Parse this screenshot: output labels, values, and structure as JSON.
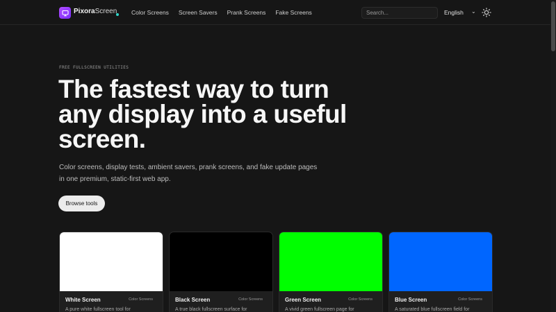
{
  "header": {
    "logo": {
      "brand": "Pixora",
      "suffix": "Screen",
      "icon": "monitor-icon"
    },
    "nav": [
      "Color Screens",
      "Screen Savers",
      "Prank Screens",
      "Fake Screens"
    ],
    "search": {
      "placeholder": "Search...",
      "value": ""
    },
    "language": "English",
    "theme_icon": "sun-icon"
  },
  "hero": {
    "eyebrow": "FREE FULLSCREEN UTILITIES",
    "headline": "The fastest way to turn any display into a useful screen.",
    "subtext": "Color screens, display tests, ambient savers, prank screens, and fake update pages in one premium, static-first web app.",
    "cta": "Browse tools"
  },
  "cards": [
    {
      "title": "White Screen",
      "tag": "Color Screens",
      "desc": "A pure white fullscreen tool for",
      "color": "#ffffff"
    },
    {
      "title": "Black Screen",
      "tag": "Color Screens",
      "desc": "A true black fullscreen surface for",
      "color": "#000000"
    },
    {
      "title": "Green Screen",
      "tag": "Color Screens",
      "desc": "A vivid green fullscreen page for",
      "color": "#00ff00"
    },
    {
      "title": "Blue Screen",
      "tag": "Color Screens",
      "desc": "A saturated blue fullscreen field for",
      "color": "#0066ff"
    }
  ],
  "colors": {
    "accent": "#9b3cff",
    "logo_dot": "#2fd6c9",
    "background": "#161616"
  }
}
